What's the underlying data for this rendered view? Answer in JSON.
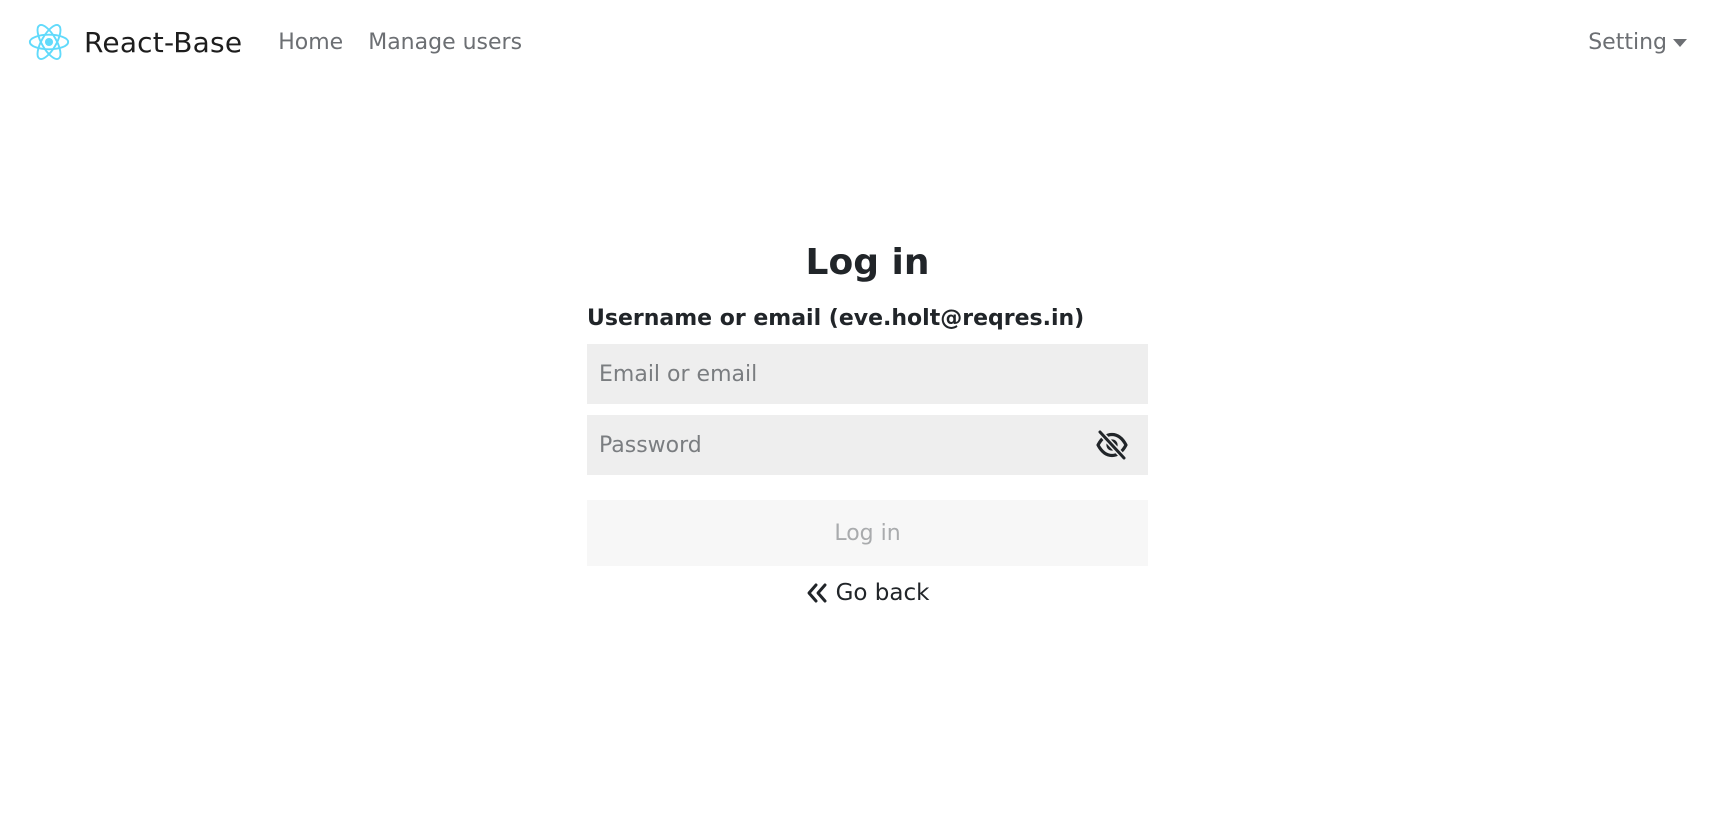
{
  "navbar": {
    "brand_name": "React-Base",
    "brand_icon": "react-atom-icon",
    "links": [
      {
        "label": "Home"
      },
      {
        "label": "Manage users"
      }
    ],
    "setting_label": "Setting"
  },
  "login": {
    "title": "Log in",
    "username_label": "Username or email (eve.holt@reqres.in)",
    "email_placeholder": "Email or email",
    "email_value": "",
    "password_placeholder": "Password",
    "password_value": "",
    "password_toggle_icon": "eye-slash-icon",
    "submit_label": "Log in",
    "go_back_icon": "double-chevron-left-icon",
    "go_back_label": "Go back"
  },
  "colors": {
    "react_logo": "#61dafb",
    "input_background": "#eeeeee",
    "button_disabled_background": "#f7f7f7",
    "button_disabled_text": "#a9abad",
    "nav_link": "#6c6f73",
    "text": "#212529"
  }
}
